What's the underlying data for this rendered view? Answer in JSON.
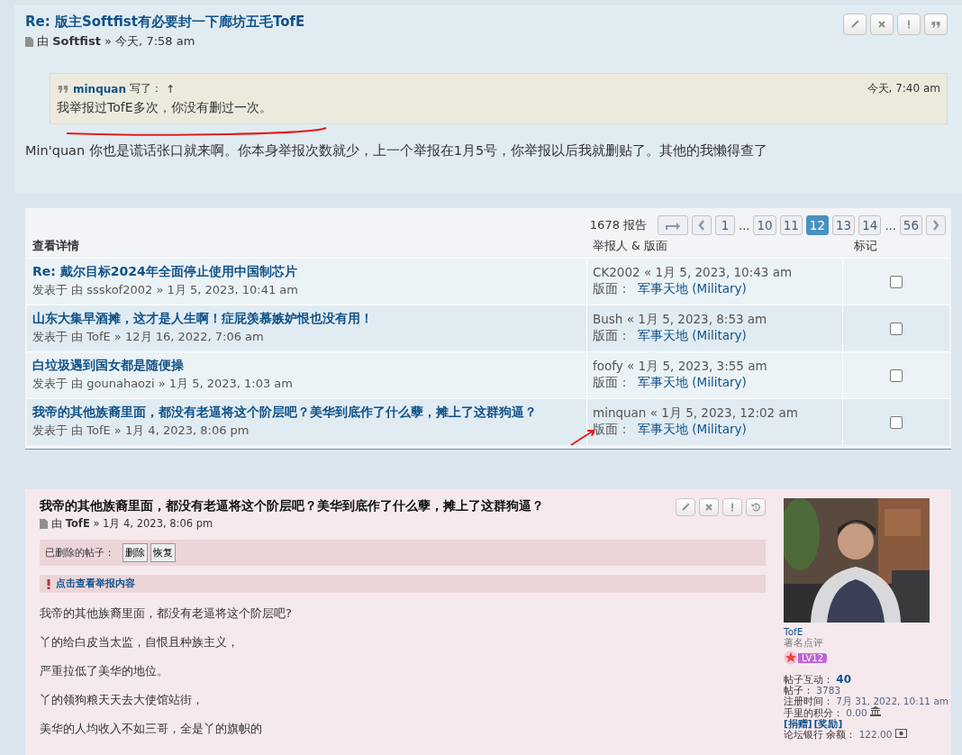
{
  "post": {
    "title": "Re: 版主Softfist有必要封一下廊坊五毛TofE",
    "byline": "由 **Softfist** » 今天, 7:58 am",
    "quote": {
      "author": "minquan",
      "wrote": "写了：",
      "up": "↑",
      "time": "今天, 7:40 am",
      "text": "我举报过TofE多次，你没有删过一次。"
    },
    "body": "Min'quan 你也是谎话张口就来啊。你本身举报次数就少，上一个举报在1月5号，你举报以后我就删贴了。其他的我懒得查了"
  },
  "reports": {
    "count": "1678 报告",
    "pages": [
      {
        "kind": "page",
        "label": "1",
        "selected": false
      },
      {
        "kind": "ellipsis",
        "label": "..."
      },
      {
        "kind": "page",
        "label": "10",
        "selected": false
      },
      {
        "kind": "page",
        "label": "11",
        "selected": false
      },
      {
        "kind": "page",
        "label": "12",
        "selected": true
      },
      {
        "kind": "page",
        "label": "13",
        "selected": false
      },
      {
        "kind": "page",
        "label": "14",
        "selected": false
      },
      {
        "kind": "ellipsis",
        "label": "..."
      },
      {
        "kind": "page",
        "label": "56",
        "selected": false
      }
    ],
    "columns": [
      "查看详情",
      "举报人 & 版面",
      "标记"
    ],
    "rows": [
      {
        "title": "Re: 戴尔目标2024年全面停止使用中国制芯片",
        "meta": "发表于 由 ssskof2002 » 1月 5, 2023, 10:41 am",
        "reporter": "CK2002 « 1月 5, 2023, 10:43 am",
        "forum_label": "版面：",
        "forum": "军事天地 (Military)",
        "checked": false
      },
      {
        "title": "山东大集早酒摊，这才是人生啊！症屁羡慕嫉妒恨也没有用！",
        "meta": "发表于 由 TofE » 12月 16, 2022, 7:06 am",
        "reporter": "Bush « 1月 5, 2023, 8:53 am",
        "forum_label": "版面：",
        "forum": "军事天地 (Military)",
        "checked": false
      },
      {
        "title": "白垃圾遇到国女都是随便操",
        "meta": "发表于 由 gounahaozi » 1月 5, 2023, 1:03 am",
        "reporter": "foofy « 1月 5, 2023, 3:55 am",
        "forum_label": "版面：",
        "forum": "军事天地 (Military)",
        "checked": false
      },
      {
        "title": "我帝的其他族裔里面，都没有老逼将这个阶层吧？美华到底作了什么孽，摊上了这群狗逼？",
        "meta": "发表于 由 TofE » 1月 4, 2023, 8:06 pm",
        "reporter": "minquan « 1月 5, 2023, 12:02 am",
        "forum_label": "版面：",
        "forum": "军事天地 (Military)",
        "checked": false
      }
    ]
  },
  "deleted_post": {
    "title": "我帝的其他族裔里面，都没有老逼将这个阶层吧？美华到底作了什么孽，摊上了这群狗逼？",
    "byline": "由 **TofE** » 1月 4, 2023, 8:06 pm",
    "deleted_label": "已删除的帖子：",
    "buttons": [
      "删除",
      "恢复"
    ],
    "report_link": "点击查看举报内容",
    "paragraphs": [
      "我帝的其他族裔里面，都没有老逼将这个阶层吧?",
      "丫的给白皮当太监，自恨且种族主义，",
      "严重拉低了美华的地位。",
      "丫的领狗粮天天去大使馆站街，",
      "美华的人均收入不如三哥，全是丫的旗帜的"
    ],
    "profile": {
      "name": "TofE",
      "rank": "著名点评",
      "level": "LV12",
      "stats": [
        {
          "kind": "plain",
          "label": "帖子互动：",
          "value": "40",
          "strong": true
        },
        {
          "kind": "plain",
          "label": "帖子：",
          "value": "3783",
          "strong": false
        },
        {
          "kind": "plain",
          "label": "注册时间：",
          "value": "7月 31, 2022, 10:11 am",
          "strong": false
        },
        {
          "kind": "bank",
          "label": "手里的积分：",
          "value": "0.00",
          "strong": false
        },
        {
          "kind": "links",
          "links": [
            "[捐赠]",
            "[奖励]"
          ]
        },
        {
          "kind": "cash",
          "label": "论坛银行 余额：",
          "value": "122.00",
          "strong": false
        }
      ]
    }
  }
}
